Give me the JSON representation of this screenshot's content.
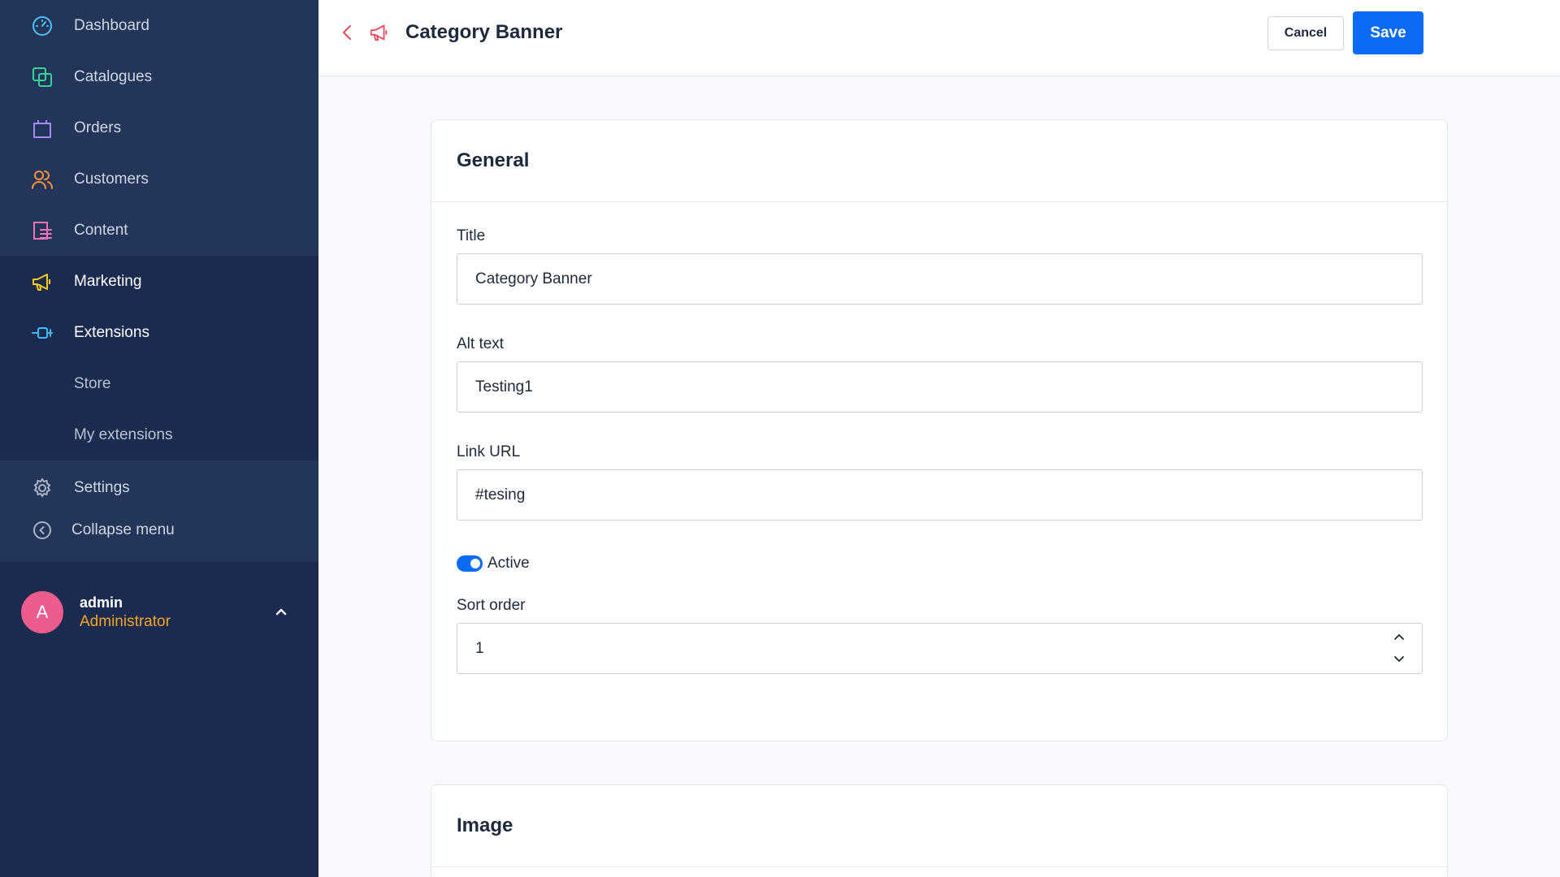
{
  "sidebar": {
    "items": [
      {
        "label": "Dashboard",
        "icon": "dashboard-icon",
        "color": "#4fc3f7"
      },
      {
        "label": "Catalogues",
        "icon": "catalogues-icon",
        "color": "#34d399"
      },
      {
        "label": "Orders",
        "icon": "orders-icon",
        "color": "#a78bfa"
      },
      {
        "label": "Customers",
        "icon": "customers-icon",
        "color": "#fb923c"
      },
      {
        "label": "Content",
        "icon": "content-icon",
        "color": "#f472b6"
      },
      {
        "label": "Marketing",
        "icon": "megaphone-icon",
        "color": "#facc15"
      },
      {
        "label": "Extensions",
        "icon": "extensions-icon",
        "color": "#38bdf8"
      }
    ],
    "sub_items": [
      "Store",
      "My extensions"
    ],
    "settings_label": "Settings",
    "collapse_label": "Collapse menu"
  },
  "user": {
    "initial": "A",
    "name": "admin",
    "role": "Administrator"
  },
  "header": {
    "title": "Category Banner",
    "cancel_label": "Cancel",
    "save_label": "Save"
  },
  "general": {
    "title": "General",
    "title_label": "Title",
    "title_value": "Category Banner",
    "alt_label": "Alt text",
    "alt_value": "Testing1",
    "link_label": "Link URL",
    "link_value": "#tesing",
    "active_label": "Active",
    "active": true,
    "sort_label": "Sort order",
    "sort_value": "1"
  },
  "image_section": {
    "title": "Image"
  },
  "colors": {
    "sidebar": "#1b2b4f",
    "accent": "#0a6cf5",
    "back_icon": "#e84a5f",
    "role": "#f5a524",
    "avatar": "#ec5b8e"
  }
}
